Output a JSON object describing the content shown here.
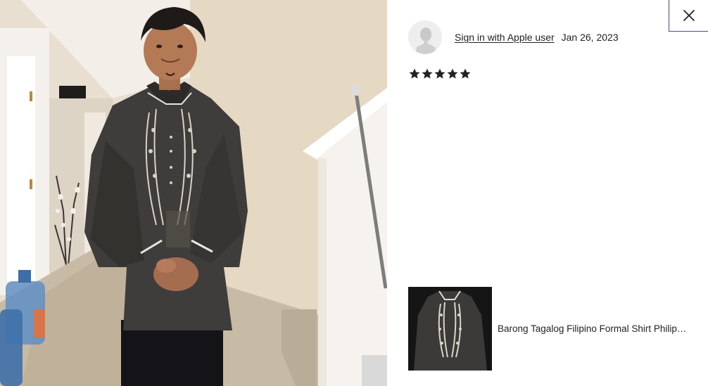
{
  "photo": {
    "description_icon": "review-photo"
  },
  "close": {
    "icon": "close-icon"
  },
  "reviewer": {
    "name_link": "Sign in with Apple user",
    "date": "Jan 26, 2023",
    "avatar_icon": "user-silhouette-icon"
  },
  "rating": {
    "value": 5,
    "max": 5
  },
  "product": {
    "title": "Barong Tagalog Filipino Formal Shirt Philip…"
  },
  "colors": {
    "accent_focus": "#3a4fb4",
    "text": "#222222",
    "star": "#222222"
  }
}
